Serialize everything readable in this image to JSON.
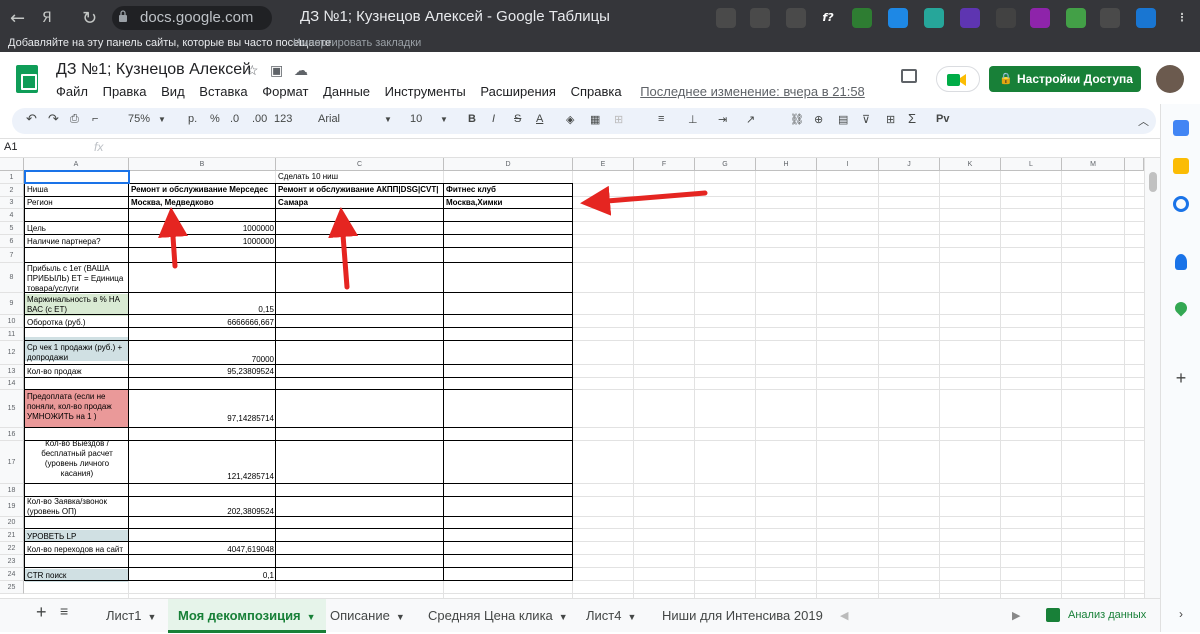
{
  "browser": {
    "back": "←",
    "forward": "Я",
    "reload": "↻",
    "url": "docs.google.com",
    "window_title": "ДЗ №1; Кузнецов Алексей - Google Таблицы",
    "bookmarks_hint": "Добавляйте на эту панель сайты, которые вы часто посещаете.",
    "bookmarks_import": "Импортировать закладки"
  },
  "doc": {
    "title": "ДЗ №1; Кузнецов Алексей",
    "menu": [
      "Файл",
      "Правка",
      "Вид",
      "Вставка",
      "Формат",
      "Данные",
      "Инструменты",
      "Расширения",
      "Справка"
    ],
    "last_edit": "Последнее изменение: вчера в 21:58",
    "share_label": "Настройки Доступа"
  },
  "toolbar": {
    "zoom": "75%",
    "currency": "р.",
    "percent": "%",
    "dec_less": ".0",
    "dec_more": ".00",
    "format_more": "123",
    "font": "Arial",
    "font_size": "10",
    "bold": "B",
    "italic": "I",
    "strike": "S",
    "text_color": "A"
  },
  "formula_bar": {
    "cell_ref": "A1",
    "fx": "fx"
  },
  "columns": [
    "A",
    "B",
    "C",
    "D",
    "E",
    "F",
    "G",
    "H",
    "I",
    "J",
    "K",
    "L",
    "M"
  ],
  "rows": [
    "1",
    "2",
    "3",
    "4",
    "5",
    "6",
    "7",
    "8",
    "9",
    "10",
    "11",
    "12",
    "13",
    "14",
    "15",
    "16",
    "17",
    "18",
    "19",
    "20",
    "21",
    "22",
    "23",
    "24",
    "25"
  ],
  "cells": {
    "c1": "Сделать 10 ниш",
    "a2": "Ниша",
    "b2": "Ремонт и обслуживание Мерседес",
    "c2": "Ремонт и обслуживание АКПП|DSG|CVT|",
    "d2": "Фитнес клуб",
    "a3": "Регион",
    "b3": "Москва, Медведково",
    "c3": "Самара",
    "d3": "Москва,Химки",
    "a5": "Цель",
    "b5": "1000000",
    "a6": "Наличие партнера?",
    "b6": "1000000",
    "a8": "Прибыль с 1ет (ВАША ПРИБЫЛЬ) ЕТ = Единица товара/услуги",
    "a9": "Маржинальность в % НА ВАС (с ЕТ)",
    "b9": "0,15",
    "a10": "Оборотка (руб.)",
    "b10": "6666666,667",
    "a12": "Ср чек 1 продажи (руб.) + допродажи",
    "b12": "70000",
    "a13": "Кол-во продаж",
    "b13": "95,23809524",
    "a15": "Предоплата (если не поняли,  кол-во продаж УМНОЖИТЬ на 1 )",
    "b15": "97,14285714",
    "a17": "Кол-во Выездов / бесплатный расчет (уровень личного касания)",
    "b17": "121,4285714",
    "a19": "Кол-во Заявка/звонок (уровень ОП)",
    "b19": "202,3809524",
    "a21": "УРОВЕТЬ LP",
    "a22": "Кол-во переходов на сайт",
    "b22": "4047,619048",
    "a24": "CTR поиск",
    "b24": "0,1"
  },
  "colors": {
    "green_fill": "#d9ead3",
    "red_fill": "#ea9999",
    "blue_fill": "#d0e0e3",
    "arrow": "#e52521",
    "accent": "#188038"
  },
  "sheets": [
    {
      "label": "Лист1",
      "active": false
    },
    {
      "label": "Моя декомпозиция",
      "active": true
    },
    {
      "label": "Описание",
      "active": false
    },
    {
      "label": "Средняя Цена клика",
      "active": false
    },
    {
      "label": "Лист4",
      "active": false
    },
    {
      "label": "Ниши для Интенсива 2019",
      "active": false
    }
  ],
  "explore_label": "Анализ данных"
}
